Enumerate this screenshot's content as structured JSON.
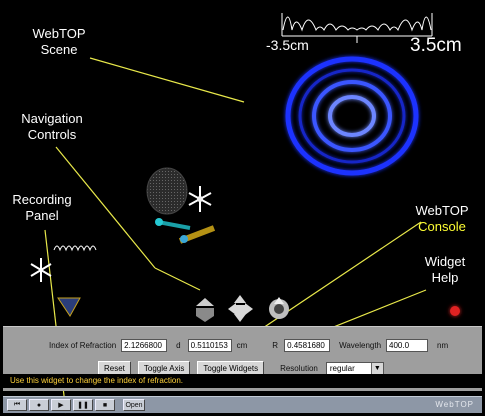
{
  "annotations": {
    "webtop_scene": {
      "line1": "WebTOP",
      "line2": "Scene"
    },
    "navigation_controls": {
      "line1": "Navigation",
      "line2": "Controls"
    },
    "recording_panel": {
      "line1": "Recording",
      "line2": "Panel"
    },
    "webtop_console": {
      "line1": "WebTOP",
      "line2": "Console"
    },
    "widget_help": {
      "line1": "Widget",
      "line2": "Help"
    }
  },
  "scene_axis": {
    "left_label": "-3.5cm",
    "right_label": "3.5cm"
  },
  "console": {
    "index_label": "Index of Refraction",
    "index_value": "2.1266800",
    "d_label": "d",
    "d_value": "0.5110153",
    "d_unit": "cm",
    "r_label": "R",
    "r_value": "0.4581680",
    "wavelength_label": "Wavelength",
    "wavelength_value": "400.0",
    "wavelength_unit": "nm",
    "reset_label": "Reset",
    "toggle_axis_label": "Toggle Axis",
    "toggle_widgets_label": "Toggle Widgets",
    "resolution_label": "Resolution",
    "resolution_value": "regular"
  },
  "help_text": "Use this widget to change the index of refraction.",
  "recording": {
    "rewind_icon": "⏮",
    "record_icon": "●",
    "play_icon": "▶",
    "pause_icon": "❚❚",
    "stop_icon": "■",
    "open_label": "Open",
    "brand": "WebTOP"
  },
  "colors": {
    "annotation_line": "#e8e84a",
    "ring_blue": "#2a3dff",
    "console_bg": "#9e9e9e",
    "help_text": "#ffd23a"
  }
}
